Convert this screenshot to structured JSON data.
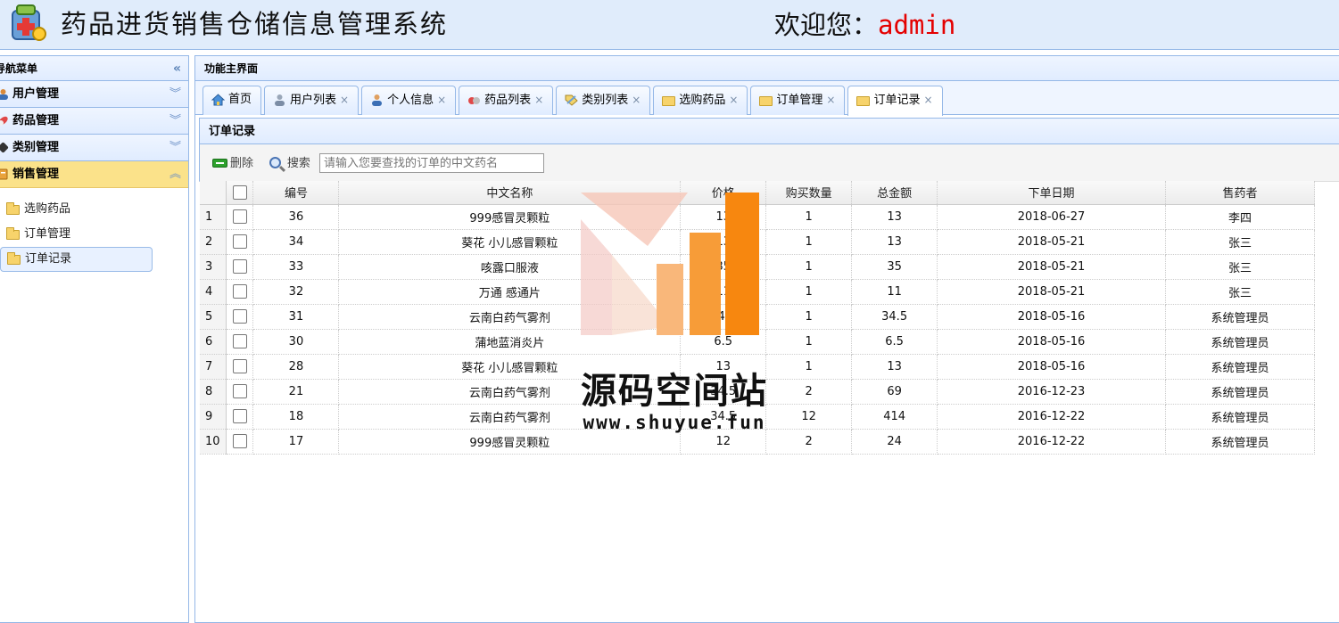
{
  "header": {
    "title": "药品进货销售仓储信息管理系统",
    "welcome_label": "欢迎您：",
    "username": "admin"
  },
  "nav": {
    "title": "导航菜单",
    "sections": [
      {
        "label": "用户管理",
        "icon": "user-icon"
      },
      {
        "label": "药品管理",
        "icon": "pill-icon"
      },
      {
        "label": "类别管理",
        "icon": "tag-icon"
      },
      {
        "label": "销售管理",
        "icon": "cart-icon"
      }
    ],
    "items": [
      {
        "label": "选购药品"
      },
      {
        "label": "订单管理"
      },
      {
        "label": "订单记录"
      }
    ]
  },
  "main": {
    "title": "功能主界面",
    "tabs": [
      {
        "label": "首页",
        "icon": "home-icon",
        "closable": false
      },
      {
        "label": "用户列表",
        "icon": "user-list-icon",
        "closable": true
      },
      {
        "label": "个人信息",
        "icon": "person-icon",
        "closable": true
      },
      {
        "label": "药品列表",
        "icon": "pill-icon",
        "closable": true
      },
      {
        "label": "类别列表",
        "icon": "tag-icon",
        "closable": true
      },
      {
        "label": "选购药品",
        "icon": "folder-icon",
        "closable": true
      },
      {
        "label": "订单管理",
        "icon": "folder-icon",
        "closable": true
      },
      {
        "label": "订单记录",
        "icon": "folder-icon",
        "closable": true,
        "selected": true
      }
    ],
    "close_glyph": "×",
    "panel_title": "订单记录",
    "toolbar": {
      "delete_label": "删除",
      "search_label": "搜索",
      "search_placeholder": "请输入您要查找的订单的中文药名"
    },
    "grid": {
      "columns": [
        "编号",
        "中文名称",
        "价格",
        "购买数量",
        "总金额",
        "下单日期",
        "售药者"
      ],
      "rows": [
        {
          "n": "1",
          "id": "36",
          "name": "999感冒灵颗粒",
          "price": "13",
          "qty": "1",
          "total": "13",
          "date": "2018-06-27",
          "seller": "李四"
        },
        {
          "n": "2",
          "id": "34",
          "name": "葵花 小儿感冒颗粒",
          "price": "13",
          "qty": "1",
          "total": "13",
          "date": "2018-05-21",
          "seller": "张三"
        },
        {
          "n": "3",
          "id": "33",
          "name": "咳露口服液",
          "price": "35",
          "qty": "1",
          "total": "35",
          "date": "2018-05-21",
          "seller": "张三"
        },
        {
          "n": "4",
          "id": "32",
          "name": "万通 感通片",
          "price": "11",
          "qty": "1",
          "total": "11",
          "date": "2018-05-21",
          "seller": "张三"
        },
        {
          "n": "5",
          "id": "31",
          "name": "云南白药气雾剂",
          "price": "34.5",
          "qty": "1",
          "total": "34.5",
          "date": "2018-05-16",
          "seller": "系统管理员"
        },
        {
          "n": "6",
          "id": "30",
          "name": "蒲地蓝消炎片",
          "price": "6.5",
          "qty": "1",
          "total": "6.5",
          "date": "2018-05-16",
          "seller": "系统管理员"
        },
        {
          "n": "7",
          "id": "28",
          "name": "葵花 小儿感冒颗粒",
          "price": "13",
          "qty": "1",
          "total": "13",
          "date": "2018-05-16",
          "seller": "系统管理员"
        },
        {
          "n": "8",
          "id": "21",
          "name": "云南白药气雾剂",
          "price": "34.5",
          "qty": "2",
          "total": "69",
          "date": "2016-12-23",
          "seller": "系统管理员"
        },
        {
          "n": "9",
          "id": "18",
          "name": "云南白药气雾剂",
          "price": "34.5",
          "qty": "12",
          "total": "414",
          "date": "2016-12-22",
          "seller": "系统管理员"
        },
        {
          "n": "10",
          "id": "17",
          "name": "999感冒灵颗粒",
          "price": "12",
          "qty": "2",
          "total": "24",
          "date": "2016-12-22",
          "seller": "系统管理员"
        }
      ]
    }
  },
  "watermark": {
    "text": "源码空间站",
    "url": "www.shuyue.fun"
  },
  "colors": {
    "header_bg": "#e0ecfb",
    "panel_border": "#95b8e7",
    "active_section": "#fbe28a",
    "username": "#e40000",
    "watermark_orange": "#f7931e"
  }
}
